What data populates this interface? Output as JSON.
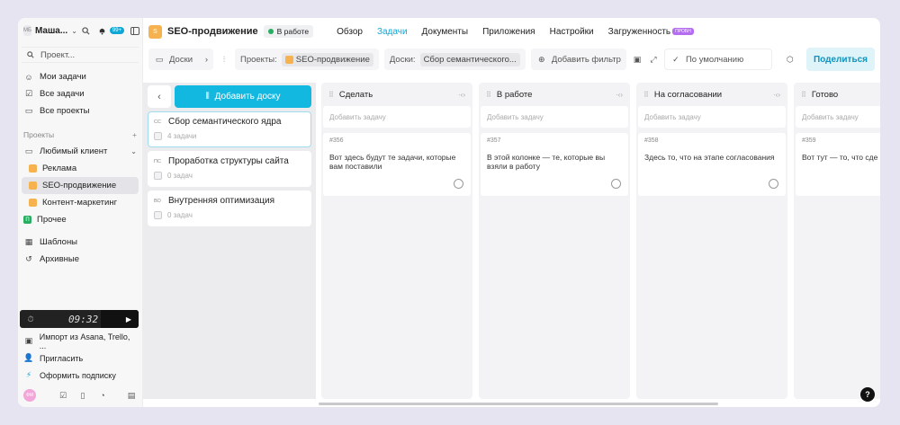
{
  "sidebar": {
    "user_initials": "МБ",
    "user_name": "Маша...",
    "notif_badge": "99+",
    "search_label": "Проект...",
    "nav": [
      {
        "label": "Мои задачи"
      },
      {
        "label": "Все задачи"
      },
      {
        "label": "Все проекты"
      }
    ],
    "projects_heading": "Проекты",
    "add_project": "+",
    "group_label": "Любимый клиент",
    "projects": [
      {
        "label": "Реклама",
        "color": "#f5b24e",
        "sub": true
      },
      {
        "label": "SEO-продвижение",
        "color": "#f5b24e",
        "sub": true,
        "active": true
      },
      {
        "label": "Контент-маркетинг",
        "color": "#f5b24e",
        "sub": true
      },
      {
        "label": "Прочее",
        "color": "#27ae60",
        "sub": false,
        "letter": "П"
      }
    ],
    "templates": "Шаблоны",
    "archive": "Архивные",
    "timer": "09:32",
    "import_label": "Импорт из Asana, Trello, ...",
    "invite_label": "Пригласить",
    "subscribe_label": "Оформить подписку",
    "footer_avatar": "ФМ"
  },
  "topbar": {
    "project_logo_letter": "S",
    "project_title": "SEO-продвижение",
    "status": "В работе",
    "tabs": [
      {
        "label": "Обзор"
      },
      {
        "label": "Задачи",
        "active": true
      },
      {
        "label": "Документы"
      },
      {
        "label": "Приложения"
      },
      {
        "label": "Настройки"
      },
      {
        "label": "Загруженность"
      }
    ],
    "beta_badge": "ПРОБН"
  },
  "toolbar": {
    "boards_label": "Доски",
    "projects_label": "Проекты:",
    "projects_value": "SEO-продвижение",
    "boards_filter_label": "Доски:",
    "boards_filter_value": "Сбор семантического...",
    "add_filter": "Добавить фильтр",
    "sort_default": "По умолчанию",
    "share": "Поделиться"
  },
  "boards": {
    "add_board": "Добавить доску",
    "items": [
      {
        "tag": "СС",
        "title": "Сбор семантического ядра",
        "count": "4 задачи",
        "active": true
      },
      {
        "tag": "ПС",
        "title": "Проработка структуры сайта",
        "count": "0 задач"
      },
      {
        "tag": "ВО",
        "title": "Внутренняя оптимизация",
        "count": "0 задач"
      }
    ]
  },
  "columns": [
    {
      "title": "Сделать",
      "add_task": "Добавить задачу",
      "task_id": "#356",
      "task_text": "Вот здесь будут те задачи, которые вам поставили"
    },
    {
      "title": "В работе",
      "add_task": "Добавить задачу",
      "task_id": "#357",
      "task_text": "В этой колонке — те, которые вы взяли в работу"
    },
    {
      "title": "На согласовании",
      "add_task": "Добавить задачу",
      "task_id": "#358",
      "task_text": "Здесь то, что на этапе согласования"
    },
    {
      "title": "Готово",
      "add_task": "Добавить задачу",
      "task_id": "#359",
      "task_text": "Вот тут — то, что сде"
    }
  ],
  "help": "?"
}
